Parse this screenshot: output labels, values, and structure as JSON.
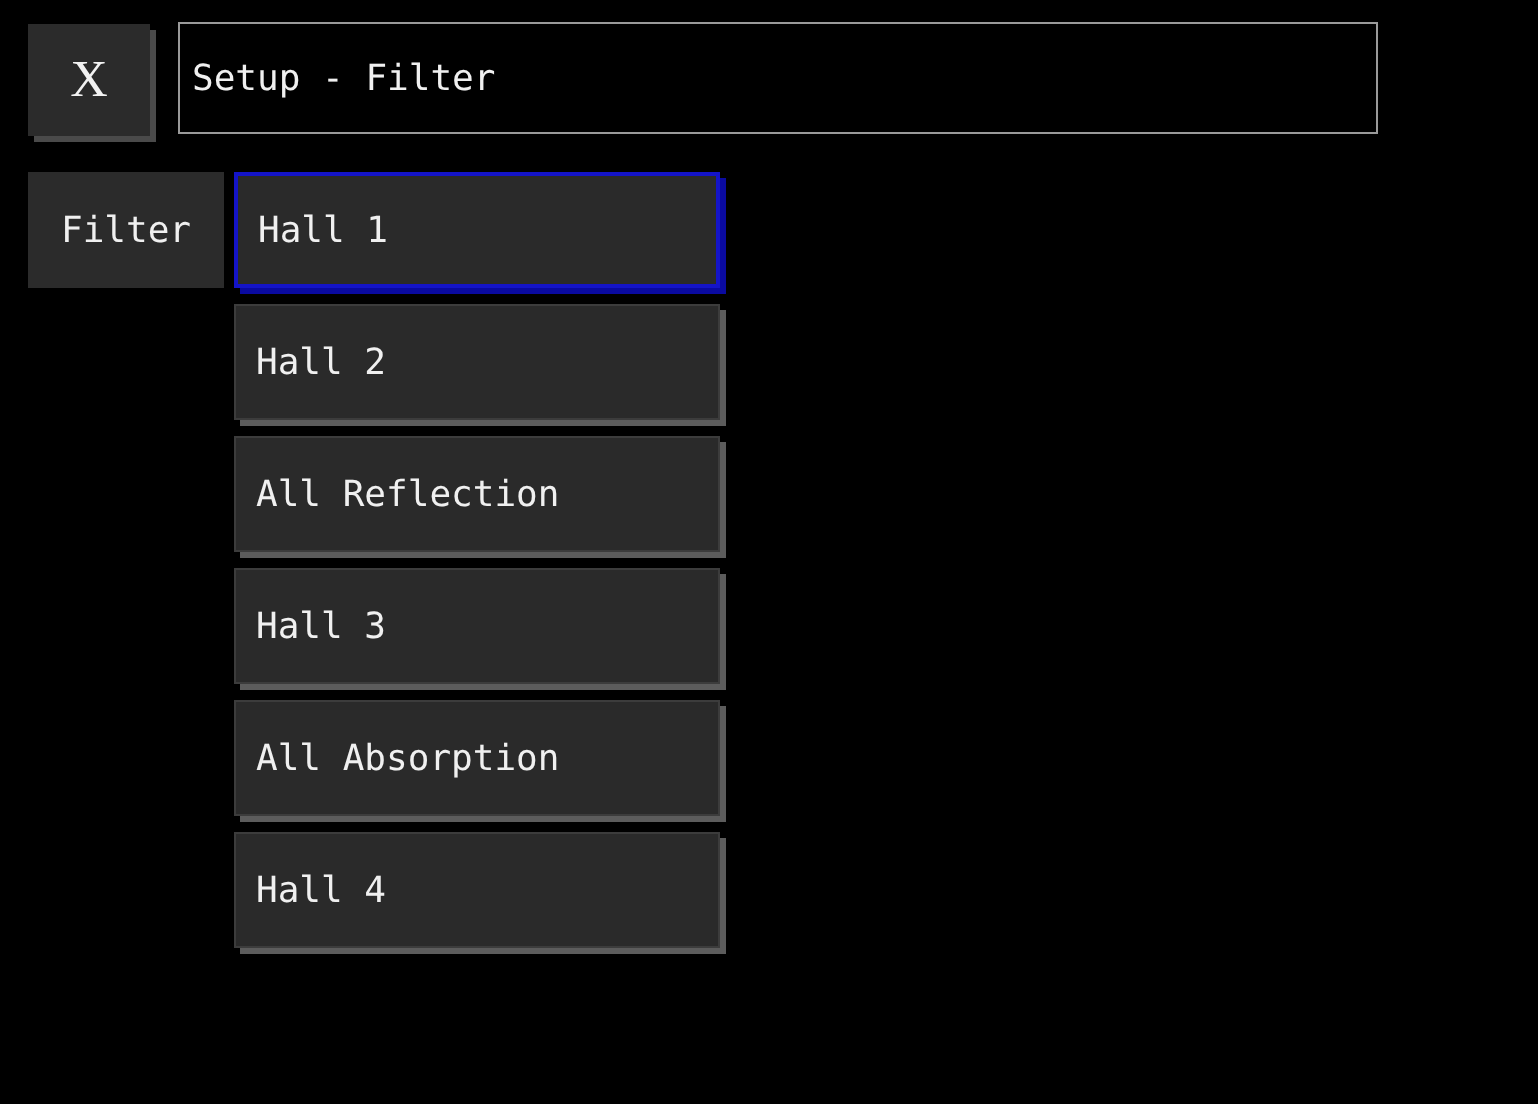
{
  "close_button": {
    "label": "X"
  },
  "title_field": {
    "value": "Setup - Filter"
  },
  "filter_label": "Filter",
  "filters": [
    {
      "label": "Hall 1",
      "selected": true
    },
    {
      "label": "Hall 2",
      "selected": false
    },
    {
      "label": "All Reflection",
      "selected": false
    },
    {
      "label": "Hall 3",
      "selected": false
    },
    {
      "label": "All Absorption",
      "selected": false
    },
    {
      "label": "Hall 4",
      "selected": false
    }
  ]
}
